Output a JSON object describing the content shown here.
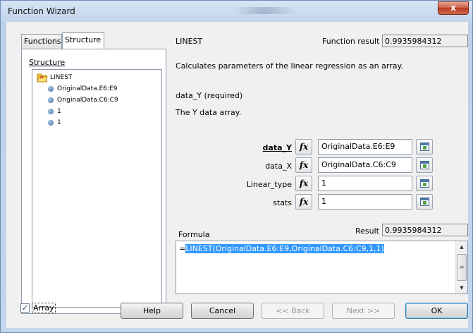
{
  "window": {
    "title": "Function Wizard",
    "close_glyph": "x"
  },
  "tabs": [
    {
      "label": "Functions"
    },
    {
      "label": "Structure"
    }
  ],
  "structure": {
    "label": "Structure",
    "root": "LINEST",
    "children": [
      "OriginalData.E6:E9",
      "OriginalData.C6:C9",
      "1",
      "1"
    ]
  },
  "function": {
    "name": "LINEST",
    "result_label": "Function result",
    "result_value": "0.9935984312",
    "description": "Calculates parameters of the linear regression as an array.",
    "arg_title": "data_Y (required)",
    "arg_description": "The Y data array."
  },
  "arguments": [
    {
      "label": "data_Y",
      "value": "OriginalData.E6:E9",
      "bold": true
    },
    {
      "label": "data_X",
      "value": "OriginalData.C6:C9",
      "bold": false
    },
    {
      "label": "Linear_type",
      "value": "1",
      "bold": false
    },
    {
      "label": "stats",
      "value": "1",
      "bold": false
    }
  ],
  "fx_glyph": "fx",
  "formula": {
    "label": "Formula",
    "result_label": "Result",
    "result_value": "0.9935984312",
    "prefix": "=",
    "selected_text": "LINEST(OriginalData.E6:E9,OriginalData.C6:C9,1,1)"
  },
  "footer": {
    "array_label": "Array",
    "array_checked": true,
    "help": "Help",
    "cancel": "Cancel",
    "back": "<< Back",
    "next": "Next >>",
    "ok": "OK"
  },
  "colors": {
    "selection": "#3399ff",
    "window_frame": "#c4d6ee",
    "close_button": "#c75a40"
  }
}
